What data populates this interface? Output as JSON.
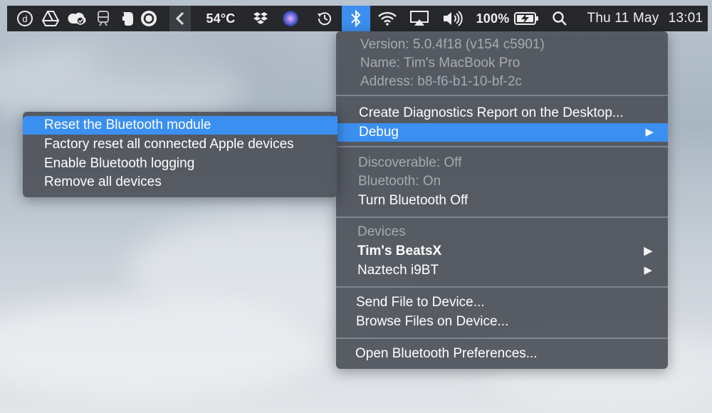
{
  "menubar": {
    "temperature": "54°C",
    "battery_percent": "100%",
    "date": "Thu 11 May",
    "time": "13:01",
    "accent_color": "#3b8ff0",
    "icons": [
      "dashlane-icon",
      "google-drive-icon",
      "creative-cloud-icon",
      "train-icon",
      "evernote-icon",
      "sync-icon",
      "k-app-icon",
      "dropbox-icon",
      "siri-icon",
      "time-machine-icon",
      "bluetooth-icon",
      "wifi-icon",
      "airplay-icon",
      "volume-icon",
      "battery-charging-icon",
      "spotlight-search-icon"
    ]
  },
  "bluetooth_menu": {
    "info": {
      "version": "Version: 5.0.4f18 (v154 c5901)",
      "name": "Name: Tim's MacBook Pro",
      "address": "Address: b8-f6-b1-10-bf-2c"
    },
    "diagnostics": "Create Diagnostics Report on the Desktop...",
    "debug": "Debug",
    "discoverable": "Discoverable: Off",
    "bluetooth_status": "Bluetooth: On",
    "turn_off": "Turn Bluetooth Off",
    "devices_header": "Devices",
    "devices": [
      "Tim's BeatsX",
      "Naztech i9BT"
    ],
    "send_file": "Send File to Device...",
    "browse_files": "Browse Files on Device...",
    "preferences": "Open Bluetooth Preferences..."
  },
  "debug_submenu": {
    "items": [
      "Reset the Bluetooth module",
      "Factory reset all connected Apple devices",
      "Enable Bluetooth logging",
      "Remove all devices"
    ]
  }
}
